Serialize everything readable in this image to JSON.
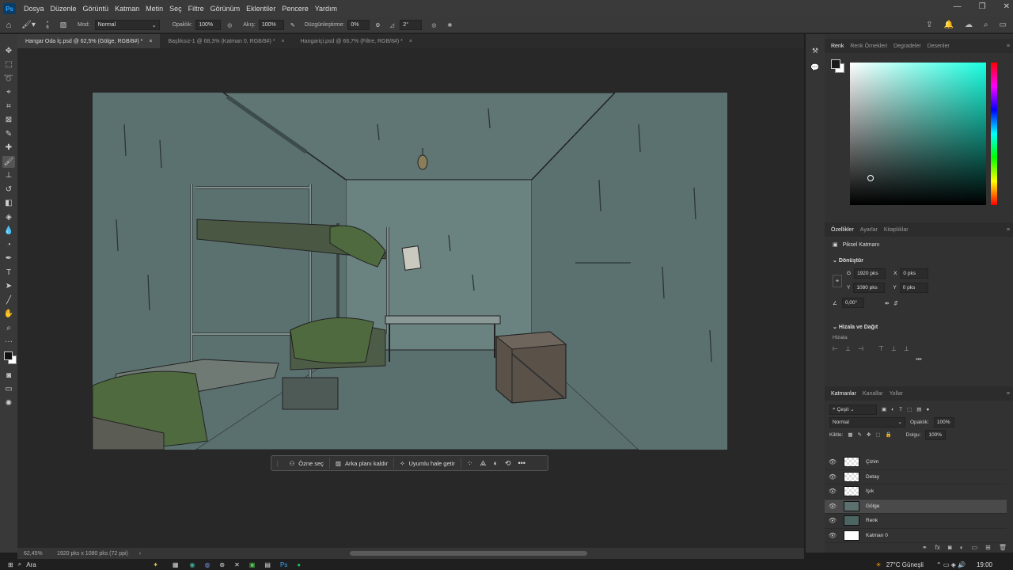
{
  "app": {
    "logo": "Ps"
  },
  "menu": [
    "Dosya",
    "Düzenle",
    "Görüntü",
    "Katman",
    "Metin",
    "Seç",
    "Filtre",
    "Görünüm",
    "Eklentiler",
    "Pencere",
    "Yardım"
  ],
  "options": {
    "brush_size": "6",
    "mode_label": "Mod:",
    "mode_value": "Normal",
    "opacity_label": "Opaklık:",
    "opacity_value": "100%",
    "flow_label": "Akış:",
    "flow_value": "100%",
    "smoothing_label": "Düzgünleştirme:",
    "smoothing_value": "0%",
    "angle_value": "2°"
  },
  "tabs": [
    {
      "label": "Hangar Oda İç.psd @ 62,5% (Gölge, RGB/8#) *",
      "close": "×"
    },
    {
      "label": "Başlıksız-1 @ 68,3% (Katman 0, RGB/8#) *",
      "close": "×"
    },
    {
      "label": "Hangariçi.psd @ 66,7% (Filtre, RGB/8#) *",
      "close": "×"
    }
  ],
  "contextbar": {
    "select_subject": "Özne seç",
    "remove_bg": "Arka planı kaldır",
    "harmonize": "Uyumlu hale getir"
  },
  "status": {
    "zoom": "62,45%",
    "doc_info": "1920 pks x 1080 pks (72 ppi)"
  },
  "color_panel": {
    "tabs": [
      "Renk",
      "Renk Örnekleri",
      "Degradeler",
      "Desenler"
    ],
    "fg_color": "#1a1a1a",
    "bg_color": "#ffffff"
  },
  "properties": {
    "tabs": [
      "Özellikler",
      "Ayarlar",
      "Kitaplıklar"
    ],
    "layer_type": "Piksel Katmanı",
    "transform_title": "Dönüştür",
    "w_label": "G",
    "w_value": "1920 pks",
    "h_label": "Y",
    "h_value": "1080 pks",
    "x_label": "X",
    "x_value": "0 pks",
    "y_label": "Y",
    "y_value": "0 pks",
    "angle_value": "0,00°",
    "align_title": "Hizala ve Dağıt",
    "align_label": "Hizala:",
    "more": "•••"
  },
  "layers_panel": {
    "tabs": [
      "Katmanlar",
      "Kanallar",
      "Yollar"
    ],
    "filter_label": "Çeşit",
    "blend_mode": "Normal",
    "opacity_label": "Opaklık:",
    "opacity_value": "100%",
    "lock_label": "Kilitle:",
    "fill_label": "Dolgu:",
    "fill_value": "100%",
    "layers": [
      {
        "name": "Çizim",
        "selected": false
      },
      {
        "name": "Detay",
        "selected": false
      },
      {
        "name": "Işık",
        "selected": false
      },
      {
        "name": "Gölge",
        "selected": true
      },
      {
        "name": "Renk",
        "selected": false
      },
      {
        "name": "Katman 0",
        "selected": false
      }
    ]
  },
  "taskbar": {
    "search": "Ara",
    "weather": "27°C  Güneşli",
    "time": "19:00"
  }
}
